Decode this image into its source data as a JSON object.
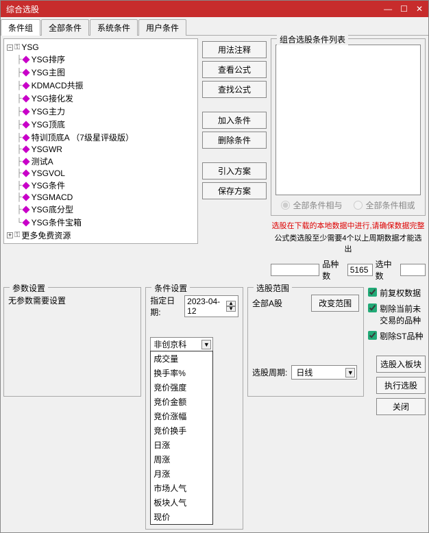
{
  "window": {
    "title": "综合选股"
  },
  "tabs": [
    "条件组",
    "全部条件",
    "系统条件",
    "用户条件"
  ],
  "tree": {
    "root": "YSG",
    "items": [
      "YSG排序",
      "YSG主图",
      "KDMACD共振",
      "YSG接化发",
      "YSG主力",
      "YSG顶底",
      "特训顶底A  （7级星评级版）",
      "YSGWR",
      "测试A",
      "YSGVOL",
      "YSG条件",
      "YSGMACD",
      "YSG底分型",
      "YSG条件宝箱"
    ],
    "root2": "更多免费资源"
  },
  "mid_buttons": [
    "用法注释",
    "查看公式",
    "查找公式"
  ],
  "mid_buttons2": [
    "加入条件",
    "删除条件"
  ],
  "mid_buttons3": [
    "引入方案",
    "保存方案"
  ],
  "combo_group": {
    "legend": "组合选股条件列表",
    "radio1": "全部条件相与",
    "radio2": "全部条件相或",
    "warn1": "选股在下载的本地数据中进行,请确保数据完整",
    "warn2": "公式类选股至少需要4个以上周期数据才能选出",
    "count_label1": "品种数",
    "count_value1": "5165",
    "count_label2": "选中数",
    "count_value2": ""
  },
  "params": {
    "legend": "参数设置",
    "text": "无参数需要设置"
  },
  "condset": {
    "legend": "条件设置",
    "date_label": "指定日期:",
    "date_value": "2023-04-12",
    "combo_value": "非创京科",
    "options": [
      "成交量",
      "换手率%",
      "竞价强度",
      "竞价金额",
      "竞价涨幅",
      "竞价换手",
      "日涨",
      "周涨",
      "月涨",
      "市场人气",
      "板块人气",
      "现价"
    ]
  },
  "scope": {
    "legend": "选股范围",
    "all_a": "全部A股",
    "change_btn": "改变范围",
    "period_label": "选股周期:",
    "period_value": "日线"
  },
  "checks": {
    "c1": "前复权数据",
    "c2": "剔除当前未交易的品种",
    "c3": "剔除ST品种"
  },
  "side_buttons": [
    "选股入板块",
    "执行选股",
    "关闭"
  ]
}
